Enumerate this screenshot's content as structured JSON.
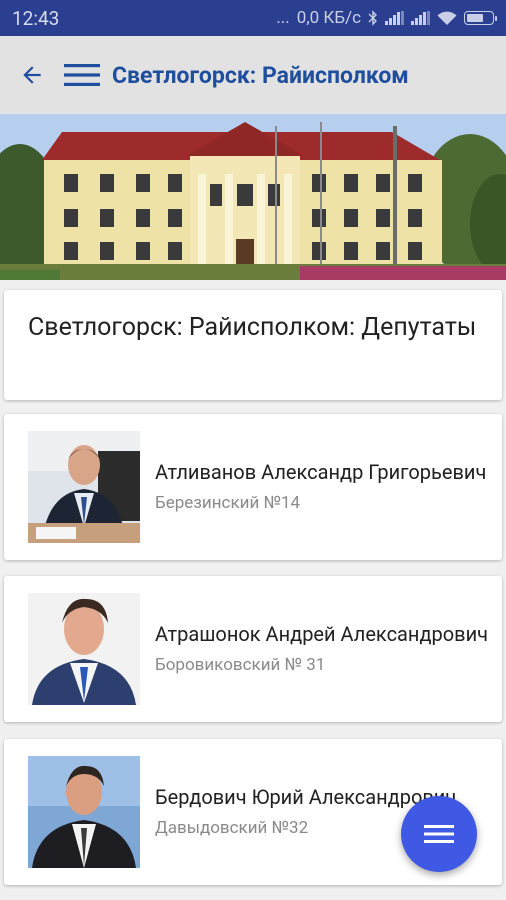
{
  "status": {
    "time": "12:43",
    "dots": "...",
    "speed": "0,0 КБ/с",
    "bluetooth_icon": "bluetooth-icon",
    "signal_icon": "signal-icon",
    "wifi_icon": "wifi-icon",
    "battery_icon": "battery-icon"
  },
  "appbar": {
    "title": "Светлогорск: Райисполком",
    "back_icon": "arrow-back-icon",
    "menu_icon": "hamburger-menu-icon"
  },
  "header": {
    "title": "Светлогорск: Райисполком: Депутаты"
  },
  "deputies": [
    {
      "name": "Атливанов Александр Григорьевич",
      "district": "Березинский №14"
    },
    {
      "name": "Атрашонок Андрей Александрович",
      "district": "Боровиковский № 31"
    },
    {
      "name": "Бердович Юрий Александрович",
      "district": "Давыдовский №32"
    }
  ],
  "fab": {
    "icon": "menu-icon"
  },
  "colors": {
    "status_bar": "#2a3f8f",
    "app_bar": "#e2e2e2",
    "title_blue": "#1f4e9e",
    "fab": "#3f59e4",
    "secondary_text": "#8a8a8a"
  }
}
